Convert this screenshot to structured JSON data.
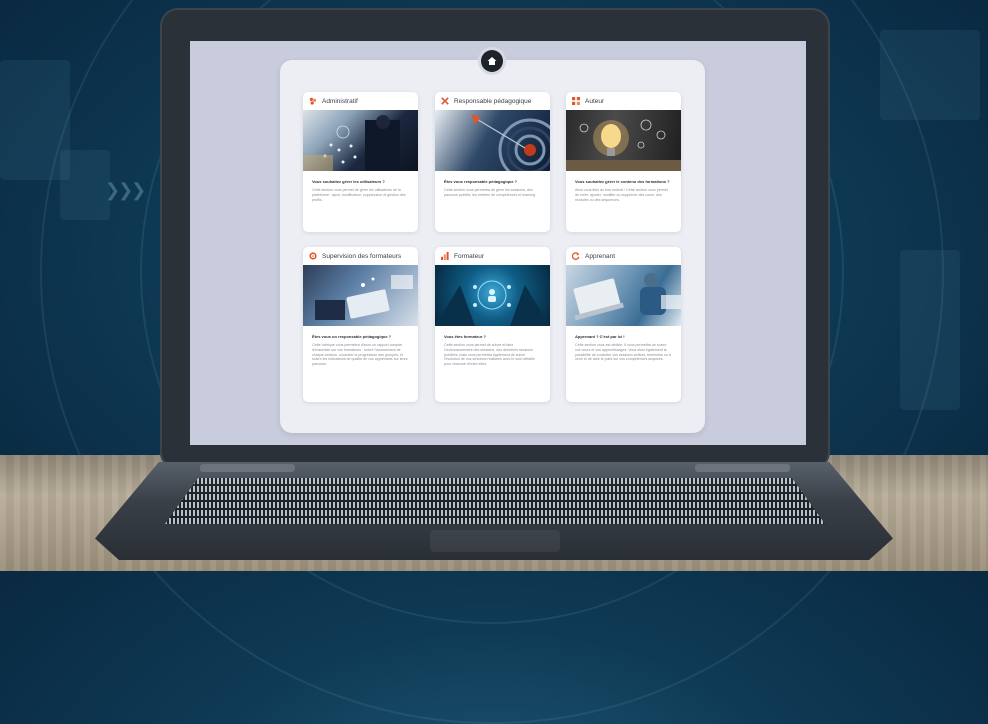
{
  "cards": [
    {
      "title": "Administratif",
      "icon": "users-icon",
      "icon_color": "#e0552e",
      "question": "Vous souhaitez gérer les utilisateurs ?",
      "text": "Cette section vous permet de gérer les utilisateurs de la plateforme : ajout, modification, suppression et gestion des profils."
    },
    {
      "title": "Responsable pédagogique",
      "icon": "tools-icon",
      "icon_color": "#e0552e",
      "question": "Êtes vous responsable pédagogique ?",
      "text": "Cette section vous permettra de gérer les sessions, des parcours publiés, les entrées de compétences et learning."
    },
    {
      "title": "Auteur",
      "icon": "grid-icon",
      "icon_color": "#e0552e",
      "question": "Vous souhaitez gérer le contenu des formations ?",
      "text": "Ainsi vous êtes au bon endroit ! Cette section vous permet de créer, ajouter, modifier ou supprimer des cours, des modules ou des séquences."
    },
    {
      "title": "Supervision des formateurs",
      "icon": "gear-icon",
      "icon_color": "#e0552e",
      "question": "Êtes vous un responsable pédagogique ?",
      "text": "Cette rubrique vous permettra d'avoir un rapport complet d'ensemble sur vos formateurs : suivre l'avancement de chaque session, consulter la progression des groupes, et suivre les indicateurs de qualité de vos apprenants sur leurs parcours."
    },
    {
      "title": "Formateur",
      "icon": "chart-icon",
      "icon_color": "#e0552e",
      "question": "Vous êtes formateur ?",
      "text": "Cette section vous permet de suivre et faire l'ordonnancement des sessions, des dernières sessions publiées, mais vous permettra également de suivre l'évolution de vos sessions réalisées avec le suivi détaillé pour chacune d'entre elles."
    },
    {
      "title": "Apprenant",
      "icon": "refresh-icon",
      "icon_color": "#e0552e",
      "question": "Apprenant ? C'est par ici !",
      "text": "Cette section vous est dédiée. Il vous permettra de suivre vos cours et vos apprentissages. Vous avez également la possibilité de consulter vos sessions actives, terminées ou à venir et de faire le point sur vos compétences acquises."
    }
  ],
  "colors": {
    "accent": "#e0552e",
    "screen_bg": "#c9ccdc",
    "panel_bg": "#eceef4"
  }
}
